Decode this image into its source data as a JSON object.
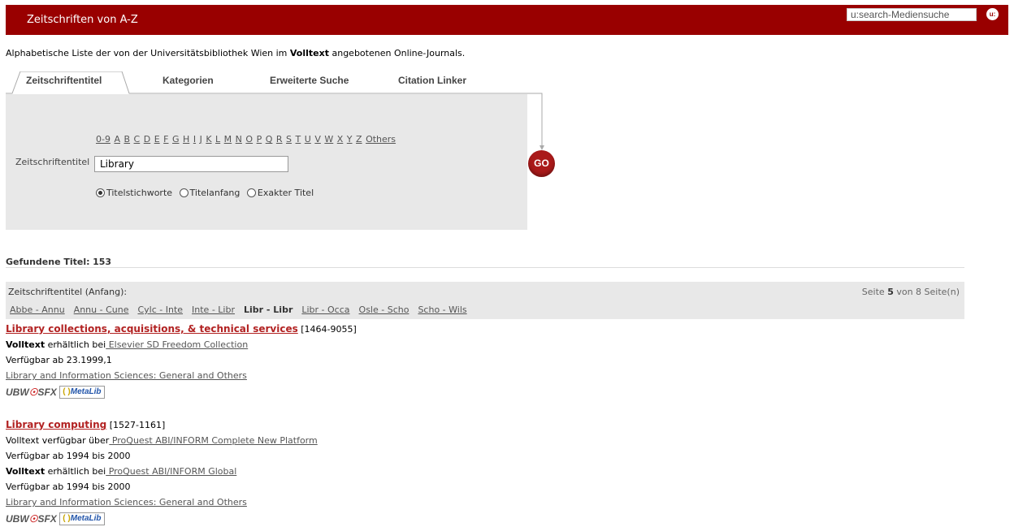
{
  "header": {
    "title": "Zeitschriften von A-Z",
    "search_value": "u:search-Mediensuche",
    "logo_text": "u:"
  },
  "intro": {
    "before": "Alphabetische Liste der von der Universitätsbibliothek Wien im ",
    "bold": "Volltext",
    "after": " angebotenen Online-Journals."
  },
  "tabs": [
    {
      "label": "Zeitschriftentitel",
      "active": true
    },
    {
      "label": "Kategorien",
      "active": false
    },
    {
      "label": "Erweiterte Suche",
      "active": false
    },
    {
      "label": "Citation Linker",
      "active": false
    }
  ],
  "alphabet": [
    "0-9",
    "A",
    "B",
    "C",
    "D",
    "E",
    "F",
    "G",
    "H",
    "I",
    "J",
    "K",
    "L",
    "M",
    "N",
    "O",
    "P",
    "Q",
    "R",
    "S",
    "T",
    "U",
    "V",
    "W",
    "X",
    "Y",
    "Z",
    "Others"
  ],
  "search_form": {
    "label": "Zeitschriftentitel",
    "value": "Library",
    "radios": [
      {
        "label": "Titelstichworte",
        "checked": true
      },
      {
        "label": "Titelanfang",
        "checked": false
      },
      {
        "label": "Exakter Titel",
        "checked": false
      }
    ],
    "go_label": "GO"
  },
  "results": {
    "found_label": "Gefundene Titel:",
    "found_count": "153",
    "range_label": "Zeitschriftentitel (Anfang):",
    "page_prefix": "Seite",
    "page_current": "5",
    "page_suffix": "von 8 Seite(n)",
    "ranges": [
      {
        "label": "Abbe - Annu",
        "current": false
      },
      {
        "label": "Annu - Cune",
        "current": false
      },
      {
        "label": "Cylc - Inte",
        "current": false
      },
      {
        "label": "Inte - Libr",
        "current": false
      },
      {
        "label": "Libr - Libr",
        "current": true
      },
      {
        "label": "Libr - Occa",
        "current": false
      },
      {
        "label": "Osle - Scho",
        "current": false
      },
      {
        "label": "Scho - Wils",
        "current": false
      }
    ]
  },
  "entries": [
    {
      "title": "Library collections, acquisitions, & technical services",
      "issn": "[1464-9055]",
      "lines": [
        {
          "bold": "Volltext",
          "text": " erhältlich bei",
          "link": " Elsevier SD Freedom Collection"
        },
        {
          "text": "Verfügbar ab 23.1999,1"
        }
      ],
      "category": "Library and Information Sciences: General and Others"
    },
    {
      "title": "Library computing",
      "issn": "[1527-1161]",
      "lines": [
        {
          "text": "Volltext verfügbar über",
          "link": " ProQuest ABI/INFORM Complete New Platform"
        },
        {
          "text": "Verfügbar ab 1994 bis 2000"
        },
        {
          "bold": "Volltext",
          "text": " erhältlich bei",
          "link": " ProQuest ABI/INFORM Global"
        },
        {
          "text": "Verfügbar ab 1994 bis 2000"
        }
      ],
      "category": "Library and Information Sciences: General and Others"
    }
  ],
  "badges": {
    "ubw": "UBW",
    "sfx": "SFX",
    "metalib": "MetaLib"
  },
  "colors": {
    "header_bg": "#990000",
    "title_red": "#b22222",
    "panel_bg": "#e8e8e8"
  }
}
